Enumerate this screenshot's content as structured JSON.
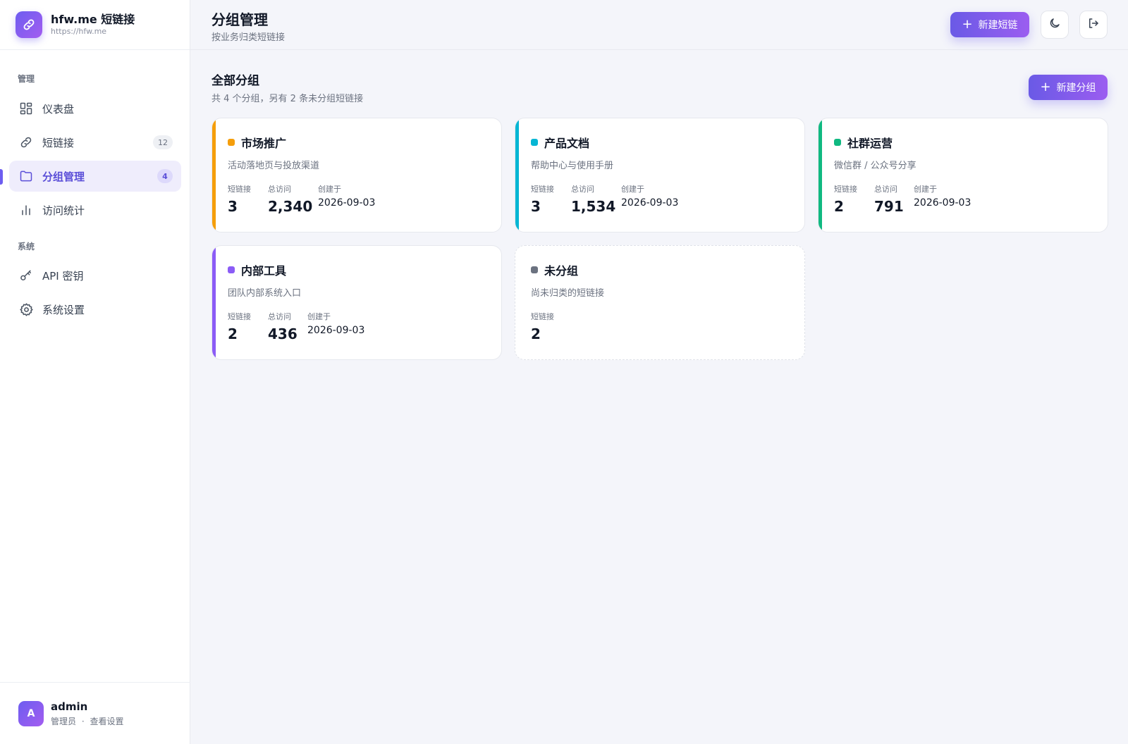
{
  "brand": {
    "title": "hfw.me 短链接",
    "url": "https://hfw.me"
  },
  "nav": {
    "section_manage": "管理",
    "section_system": "系统",
    "items": [
      {
        "label": "仪表盘",
        "icon": "dashboard-icon"
      },
      {
        "label": "短链接",
        "icon": "link-icon",
        "count": "12"
      },
      {
        "label": "分组管理",
        "icon": "folder-icon",
        "count": "4",
        "active": true
      },
      {
        "label": "访问统计",
        "icon": "bar-chart-icon"
      },
      {
        "label": "API 密钥",
        "icon": "key-icon"
      },
      {
        "label": "系统设置",
        "icon": "gear-icon"
      }
    ]
  },
  "user": {
    "initial": "A",
    "name": "admin",
    "role": "管理员",
    "separator": "·",
    "settings_link": "查看设置"
  },
  "header": {
    "title": "分组管理",
    "subtitle": "按业务归类短链接",
    "new_link_label": "新建短链",
    "theme_icon": "moon-icon",
    "logout_icon": "logout-icon"
  },
  "main": {
    "section_title": "全部分组",
    "section_subtitle": "共 4 个分组，另有 2 条未分组短链接",
    "new_group_label": "新建分组",
    "labels": {
      "links": "短链接",
      "visits": "总访问",
      "created": "创建于"
    },
    "groups": [
      {
        "name": "市场推广",
        "desc": "活动落地页与投放渠道",
        "links": "3",
        "visits": "2,340",
        "created": "2026-09-03",
        "color": "#f59e0b"
      },
      {
        "name": "产品文档",
        "desc": "帮助中心与使用手册",
        "links": "3",
        "visits": "1,534",
        "created": "2026-09-03",
        "color": "#06b6d4"
      },
      {
        "name": "社群运营",
        "desc": "微信群 / 公众号分享",
        "links": "2",
        "visits": "791",
        "created": "2026-09-03",
        "color": "#10b981"
      },
      {
        "name": "内部工具",
        "desc": "团队内部系统入口",
        "links": "2",
        "visits": "436",
        "created": "2026-09-03",
        "color": "#8b5cf6"
      }
    ],
    "ungrouped": {
      "name": "未分组",
      "desc": "尚未归类的短链接",
      "links": "2",
      "color": "#6b7280"
    }
  },
  "colors": {
    "accent": "#6d5df0",
    "accent_end": "#9b5df0",
    "background": "#f4f5fa"
  }
}
